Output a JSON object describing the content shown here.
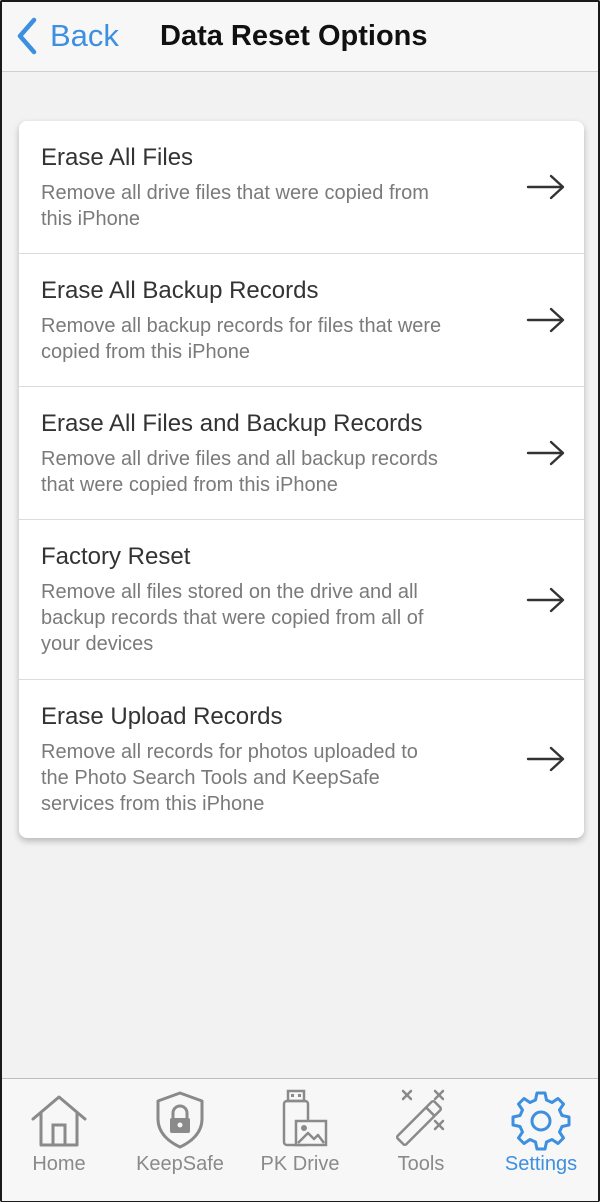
{
  "header": {
    "back_label": "Back",
    "title": "Data Reset Options"
  },
  "options": [
    {
      "title": "Erase All Files",
      "desc_lines": [
        "Remove all drive files that were copied from",
        "this iPhone"
      ]
    },
    {
      "title": "Erase All Backup Records",
      "desc_lines": [
        "Remove all backup records for files that were",
        "copied from this iPhone"
      ]
    },
    {
      "title": "Erase All Files and Backup Records",
      "desc_lines": [
        "Remove all drive files and all backup records",
        "that were copied from this iPhone"
      ]
    },
    {
      "title": "Factory Reset",
      "desc_lines": [
        "Remove all files stored on the drive and all",
        "backup records that were copied from all of",
        "your devices"
      ]
    },
    {
      "title": "Erase Upload Records",
      "desc_lines": [
        "Remove all records for photos uploaded to",
        "the Photo Search Tools and KeepSafe",
        "services from this iPhone"
      ]
    }
  ],
  "tabs": [
    {
      "label": "Home",
      "icon": "home-icon"
    },
    {
      "label": "KeepSafe",
      "icon": "shield-lock-icon"
    },
    {
      "label": "PK Drive",
      "icon": "drive-photo-icon"
    },
    {
      "label": "Tools",
      "icon": "magic-wand-icon"
    },
    {
      "label": "Settings",
      "icon": "gear-icon",
      "active": true
    }
  ],
  "colors": {
    "accent": "#3d8fe0",
    "inactive": "#8a8a8a"
  }
}
